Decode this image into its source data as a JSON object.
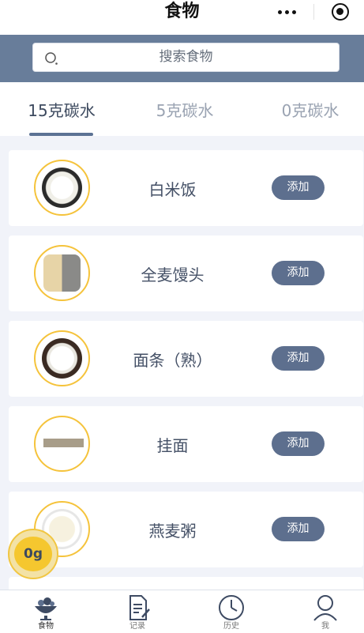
{
  "header": {
    "title": "食物"
  },
  "search": {
    "placeholder": "搜索食物"
  },
  "tabs": [
    {
      "label": "15克碳水",
      "active": true
    },
    {
      "label": "5克碳水",
      "active": false
    },
    {
      "label": "0克碳水",
      "active": false
    }
  ],
  "foods": [
    {
      "name": "白米饭",
      "add_label": "添加",
      "image": "rice-bowl"
    },
    {
      "name": "全麦馒头",
      "add_label": "添加",
      "image": "steamed-bun"
    },
    {
      "name": "面条（熟）",
      "add_label": "添加",
      "image": "noodle-bowl"
    },
    {
      "name": "挂面",
      "add_label": "添加",
      "image": "dry-noodles"
    },
    {
      "name": "燕麦粥",
      "add_label": "添加",
      "image": "oat-porridge"
    }
  ],
  "carb_badge": {
    "value": "0g"
  },
  "nav": [
    {
      "label": "食物",
      "icon": "food-bowl-icon",
      "active": true
    },
    {
      "label": "记录",
      "icon": "notes-icon",
      "active": false
    },
    {
      "label": "历史",
      "icon": "clock-icon",
      "active": false
    },
    {
      "label": "我",
      "icon": "person-icon",
      "active": false
    }
  ],
  "colors": {
    "accent": "#5d6f8e",
    "search_band": "#687d9a",
    "highlight": "#f5c72f"
  }
}
